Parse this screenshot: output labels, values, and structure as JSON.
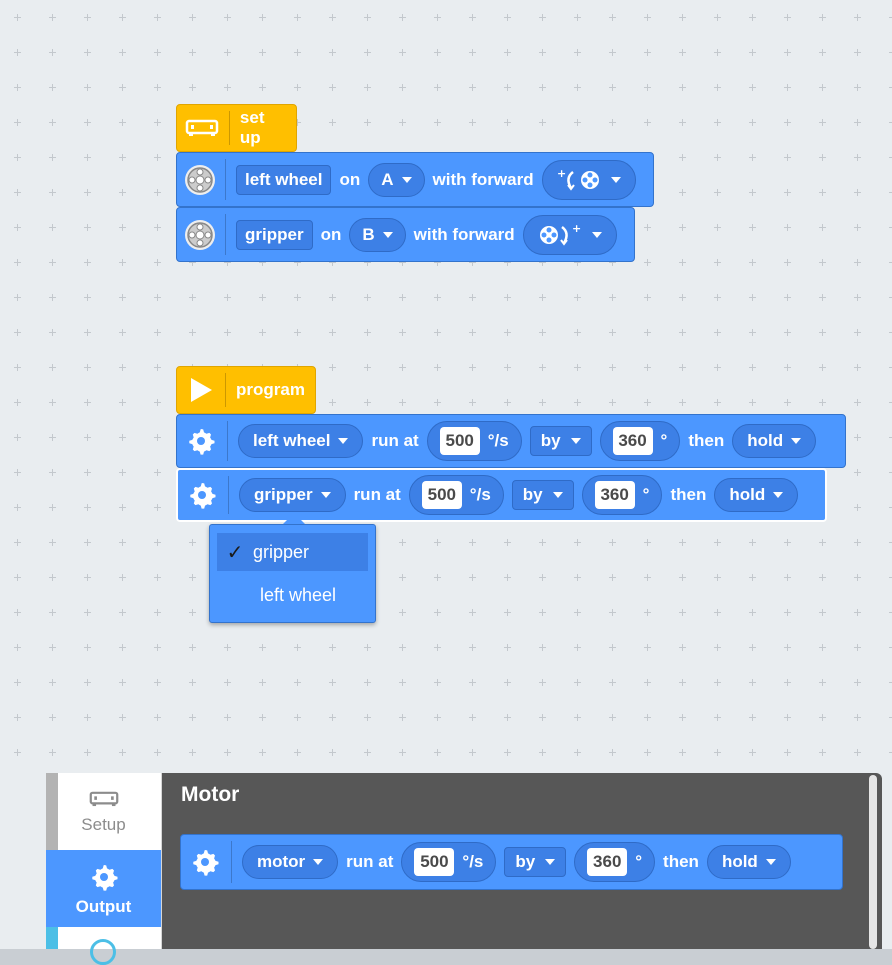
{
  "colors": {
    "motion_blue": "#4c97ff",
    "event_yellow": "#ffbf00",
    "flyout_bg": "#575757"
  },
  "setup_script": {
    "hat_label": "set up",
    "hat_icon": "robot-brick-icon",
    "blocks": [
      {
        "icon": "wheel-icon",
        "motor_name": "left wheel",
        "on_label": "on",
        "port": "A",
        "forward_label": "with forward",
        "direction_icon": "counterclockwise-wheel-icon"
      },
      {
        "icon": "wheel-icon",
        "motor_name": "gripper",
        "on_label": "on",
        "port": "B",
        "forward_label": "with forward",
        "direction_icon": "clockwise-wheel-icon"
      }
    ]
  },
  "program_script": {
    "hat_label": "program",
    "hat_icon": "play-icon",
    "blocks": [
      {
        "icon": "gear-icon",
        "motor": "left wheel",
        "run_at_label": "run at",
        "speed": "500",
        "speed_unit": "°/s",
        "by_option": "by",
        "amount": "360",
        "amount_unit": "°",
        "then_label": "then",
        "end_action": "hold"
      },
      {
        "icon": "gear-icon",
        "motor": "gripper",
        "run_at_label": "run at",
        "speed": "500",
        "speed_unit": "°/s",
        "by_option": "by",
        "amount": "360",
        "amount_unit": "°",
        "then_label": "then",
        "end_action": "hold"
      }
    ]
  },
  "dropdown": {
    "check": "✓",
    "items": [
      {
        "label": "gripper",
        "selected": true
      },
      {
        "label": "left wheel",
        "selected": false
      }
    ]
  },
  "sidebar": {
    "categories": [
      {
        "label": "Setup",
        "icon": "robot-brick-icon",
        "active": false
      },
      {
        "label": "Output",
        "icon": "gear-icon",
        "active": true
      }
    ]
  },
  "flyout": {
    "title": "Motor",
    "block": {
      "motor": "motor",
      "run_at_label": "run at",
      "speed": "500",
      "speed_unit": "°/s",
      "by_option": "by",
      "amount": "360",
      "amount_unit": "°",
      "then_label": "then",
      "end_action": "hold"
    }
  }
}
